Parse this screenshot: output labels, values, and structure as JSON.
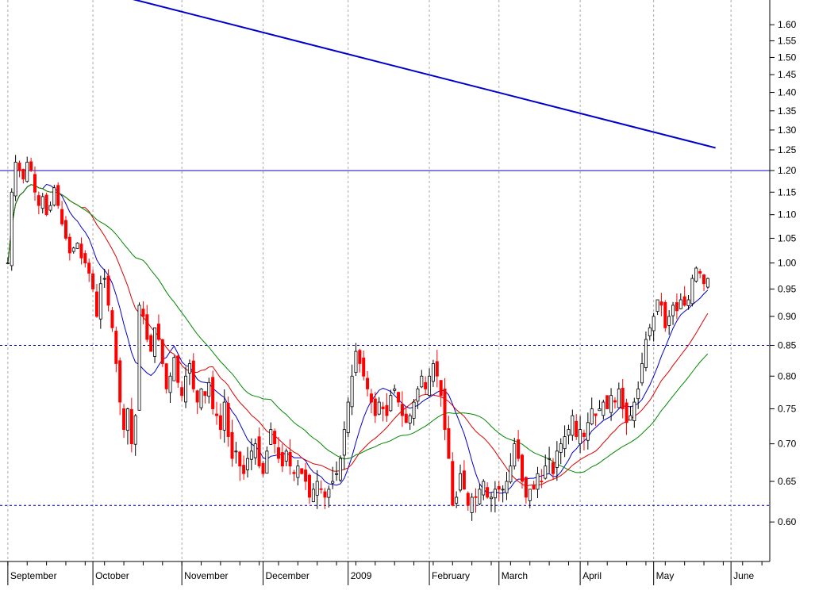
{
  "chart_data": {
    "type": "candlestick",
    "y_scale": "log",
    "ylim": [
      0.555,
      1.68
    ],
    "y_ticks": [
      "1.60",
      "1.55",
      "1.50",
      "1.45",
      "1.40",
      "1.35",
      "1.30",
      "1.25",
      "1.20",
      "1.15",
      "1.10",
      "1.05",
      "1.00",
      "0.95",
      "0.90",
      "0.85",
      "0.80",
      "0.75",
      "0.70",
      "0.65",
      "0.60"
    ],
    "x_labels": [
      {
        "label": "September",
        "day": 0
      },
      {
        "label": "October",
        "day": 22
      },
      {
        "label": "November",
        "day": 45
      },
      {
        "label": "December",
        "day": 66
      },
      {
        "label": "2009",
        "day": 88
      },
      {
        "label": "February",
        "day": 109
      },
      {
        "label": "March",
        "day": 127
      },
      {
        "label": "April",
        "day": 148
      },
      {
        "label": "May",
        "day": 167
      },
      {
        "label": "June",
        "day": 187
      }
    ],
    "x_range_days": [
      -1,
      196
    ],
    "colors": {
      "up": "#ffffff",
      "down": "#ff0000",
      "outline": "#000000",
      "ma_short": "#0000cc",
      "ma_mid": "#dd0000",
      "ma_long": "#008800",
      "trendline": "#0000cc",
      "hline": "#0000cc",
      "dashed": "#0000aa"
    },
    "reference_lines": [
      {
        "kind": "solid",
        "value": 1.2
      },
      {
        "kind": "dashed",
        "value": 0.85
      },
      {
        "kind": "dashed",
        "value": 0.62
      }
    ],
    "trendline": {
      "from": {
        "day": 21,
        "value": 1.72
      },
      "to": {
        "day": 183,
        "value": 1.255
      }
    },
    "closes": [
      1.0,
      1.15,
      1.22,
      1.2,
      1.18,
      1.22,
      1.2,
      1.15,
      1.12,
      1.14,
      1.1,
      1.12,
      1.16,
      1.12,
      1.08,
      1.05,
      1.02,
      1.03,
      1.04,
      1.01,
      1.0,
      0.98,
      0.95,
      0.9,
      0.96,
      0.97,
      0.92,
      0.88,
      0.82,
      0.76,
      0.72,
      0.75,
      0.7,
      0.74,
      0.92,
      0.9,
      0.86,
      0.84,
      0.88,
      0.86,
      0.82,
      0.78,
      0.8,
      0.83,
      0.79,
      0.77,
      0.8,
      0.82,
      0.78,
      0.76,
      0.78,
      0.77,
      0.79,
      0.75,
      0.74,
      0.72,
      0.76,
      0.71,
      0.68,
      0.69,
      0.67,
      0.66,
      0.68,
      0.69,
      0.7,
      0.67,
      0.66,
      0.69,
      0.72,
      0.7,
      0.68,
      0.67,
      0.69,
      0.67,
      0.66,
      0.67,
      0.66,
      0.65,
      0.63,
      0.64,
      0.65,
      0.64,
      0.63,
      0.64,
      0.65,
      0.66,
      0.68,
      0.72,
      0.76,
      0.8,
      0.84,
      0.82,
      0.8,
      0.78,
      0.76,
      0.74,
      0.76,
      0.75,
      0.74,
      0.77,
      0.78,
      0.76,
      0.74,
      0.73,
      0.74,
      0.76,
      0.78,
      0.8,
      0.78,
      0.8,
      0.82,
      0.8,
      0.77,
      0.72,
      0.68,
      0.62,
      0.63,
      0.66,
      0.64,
      0.62,
      0.63,
      0.63,
      0.64,
      0.65,
      0.63,
      0.63,
      0.64,
      0.64,
      0.64,
      0.65,
      0.67,
      0.7,
      0.68,
      0.65,
      0.63,
      0.64,
      0.64,
      0.66,
      0.65,
      0.67,
      0.68,
      0.66,
      0.69,
      0.7,
      0.71,
      0.72,
      0.74,
      0.71,
      0.72,
      0.71,
      0.73,
      0.75,
      0.74,
      0.75,
      0.76,
      0.75,
      0.77,
      0.76,
      0.78,
      0.75,
      0.73,
      0.74,
      0.76,
      0.78,
      0.82,
      0.86,
      0.88,
      0.9,
      0.93,
      0.92,
      0.88,
      0.9,
      0.92,
      0.91,
      0.93,
      0.92,
      0.93,
      0.97,
      0.99,
      0.98,
      0.96,
      0.97
    ]
  }
}
